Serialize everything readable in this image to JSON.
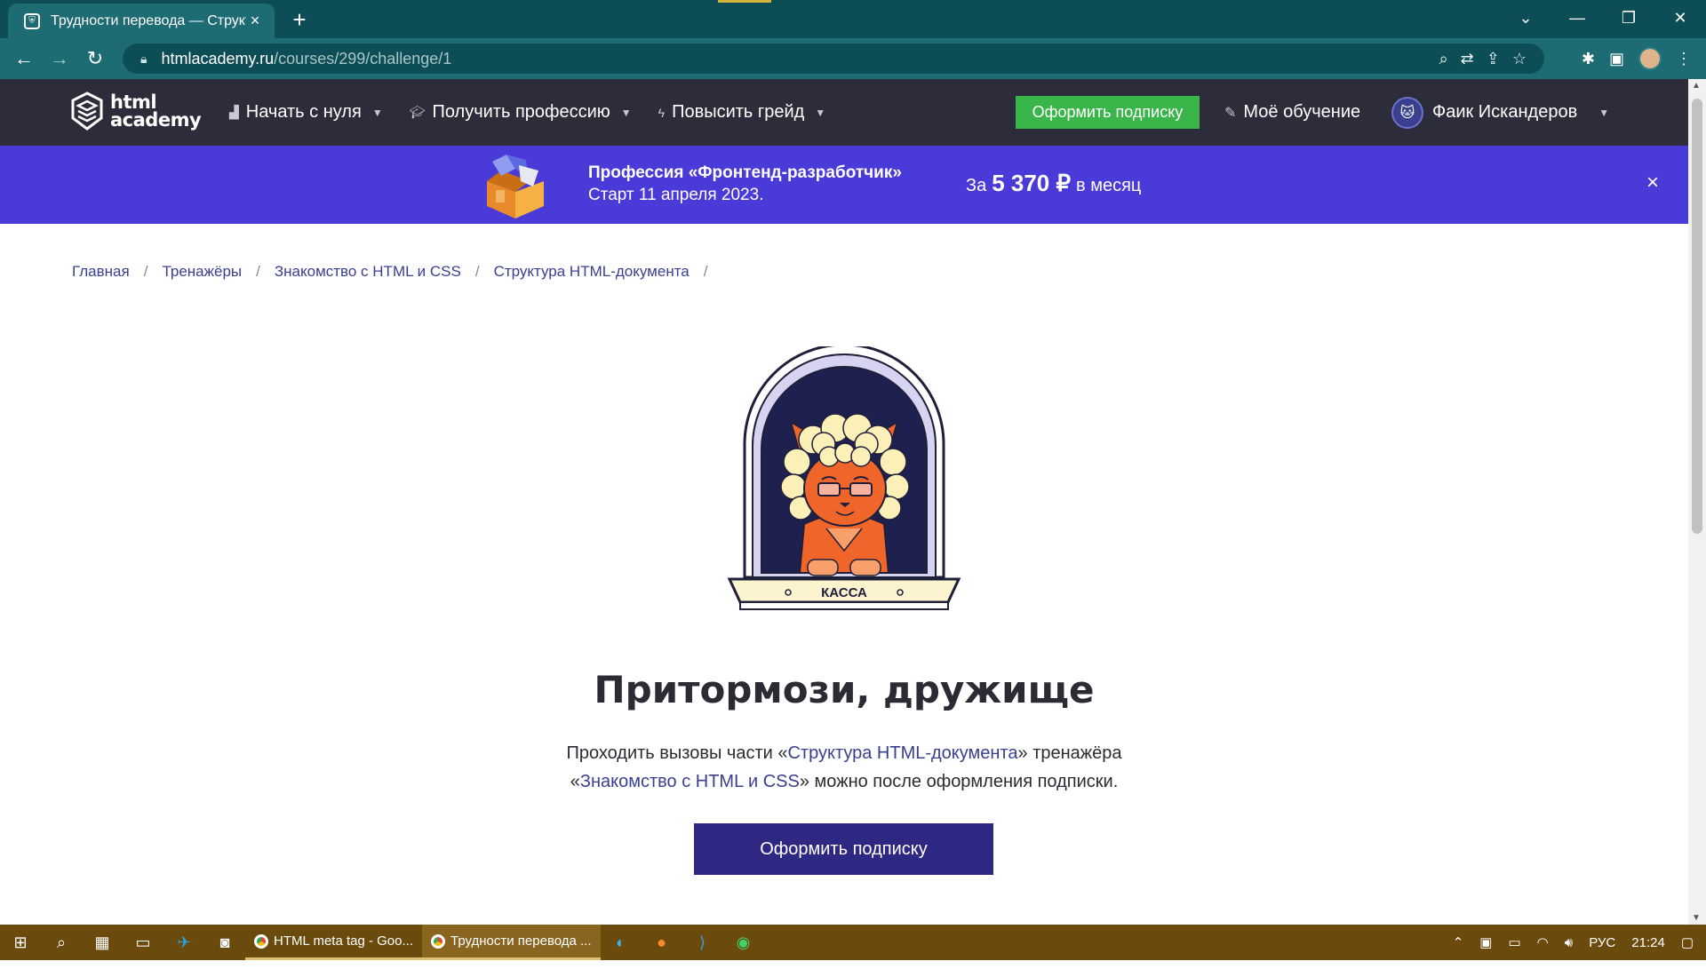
{
  "browser": {
    "tab_title": "Трудности перевода — Структу",
    "tab_close": "×",
    "new_tab": "+",
    "url_host": "htmlacademy.ru",
    "url_path": "/courses/299/challenge/1",
    "window_controls": [
      "⌄",
      "—",
      "❐",
      "✕"
    ]
  },
  "header": {
    "logo_line1": "html",
    "logo_line2": "academy",
    "menu": [
      {
        "label": "Начать с нуля",
        "icon": "bars-icon"
      },
      {
        "label": "Получить профессию",
        "icon": "graduation-cap-icon"
      },
      {
        "label": "Повысить грейд",
        "icon": "lightning-icon"
      }
    ],
    "subscribe_label": "Оформить подписку",
    "my_learning_label": "Моё обучение",
    "user_name": "Фаик Искандеров"
  },
  "promo": {
    "title": "Профессия «Фронтенд-разработчик»",
    "date": "Старт 11 апреля 2023.",
    "price_prefix": "За",
    "price_amount": "5 370 ₽",
    "price_suffix": "в месяц",
    "close": "×"
  },
  "breadcrumbs": [
    "Главная",
    "Тренажёры",
    "Знакомство с HTML и CSS",
    "Структура HTML-документа"
  ],
  "illustration": {
    "sign": "КАССА"
  },
  "main": {
    "title": "Притормози, дружище",
    "text_part1": "Проходить вызовы части «",
    "link1": "Структура HTML-документа",
    "text_part2": "» тренажёра",
    "text_part3": "«",
    "link2": "Знакомство с HTML и CSS",
    "text_part4": "» можно после оформления подписки.",
    "button_label": "Оформить подписку"
  },
  "taskbar": {
    "apps": [
      {
        "label": "HTML meta tag - Goo...",
        "active": false
      },
      {
        "label": "Трудности перевода ...",
        "active": true
      }
    ],
    "language": "РУС",
    "time": "21:24"
  },
  "colors": {
    "header_bg": "#2c2c3b",
    "promo_bg": "#4a3ad8",
    "green_button": "#39b54a",
    "primary_button": "#2e2882",
    "link": "#3a3f8f"
  }
}
